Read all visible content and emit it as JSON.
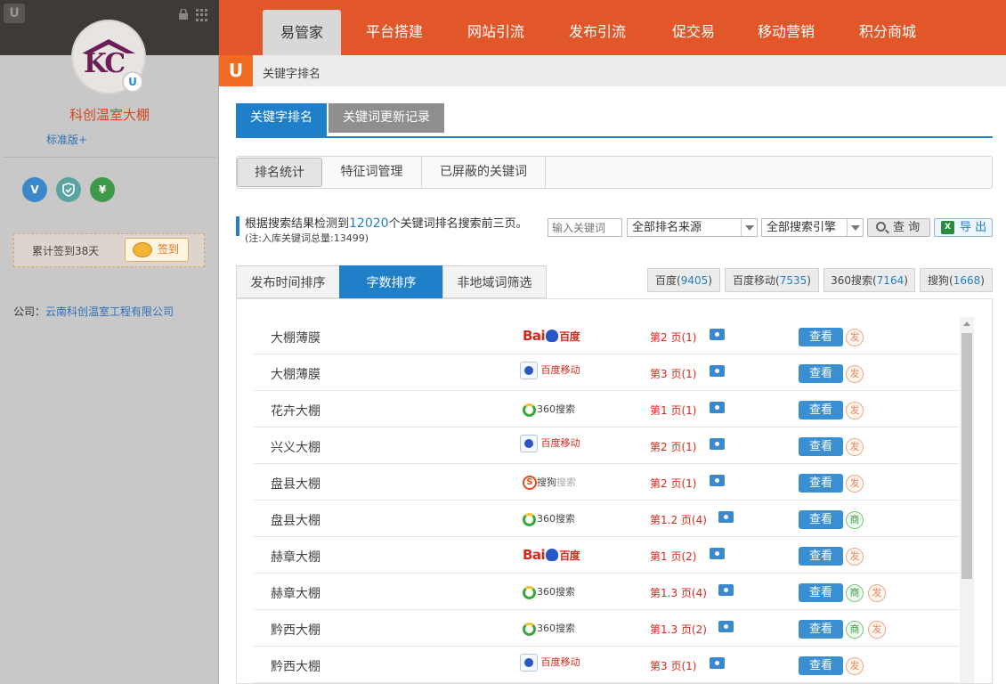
{
  "sidebar": {
    "company_name": "科创温室大棚",
    "edition": "标准版+",
    "avatar_text": "KC",
    "checkin_text": "累计签到38天",
    "checkin_button": "签到",
    "company_label": "公司：",
    "company_link": "云南科创温室工程有限公司",
    "icons": [
      "v-icon",
      "shield-icon",
      "yuan-icon"
    ]
  },
  "nav": {
    "items": [
      "易管家",
      "平台搭建",
      "网站引流",
      "发布引流",
      "促交易",
      "移动营销",
      "积分商城"
    ],
    "active": "易管家"
  },
  "breadcrumb": {
    "text": "关键字排名"
  },
  "main_tabs": [
    "关键字排名",
    "关键词更新记录"
  ],
  "sub_tabs": [
    "排名统计",
    "特征词管理",
    "已屏蔽的关键词"
  ],
  "info": {
    "prefix": "根据搜索结果检测到",
    "count": "12020",
    "suffix": "个关键词排名搜索前三页。",
    "note": "(注:入库关键词总量:13499)"
  },
  "filters": {
    "keyword_placeholder": "输入关键词",
    "source_select": "全部排名来源",
    "engine_select": "全部搜索引擎",
    "query_button": "查 询",
    "export_button": "导 出"
  },
  "sort_tabs": [
    "发布时间排序",
    "字数排序",
    "非地域词筛选"
  ],
  "engine_counts": [
    {
      "name": "百度",
      "count": "9405"
    },
    {
      "name": "百度移动",
      "count": "7535"
    },
    {
      "name": "360搜索",
      "count": "7164"
    },
    {
      "name": "搜狗",
      "count": "1668"
    }
  ],
  "engine_labels": {
    "baidu_a": "Bai",
    "baidu_b": "百度",
    "baidu_mobile": "百度移动",
    "s360": "360搜索",
    "sogou_a": "搜狗",
    "sogou_b": "搜索"
  },
  "view_label": "查看",
  "tag_labels": {
    "fa": "发",
    "shang": "商"
  },
  "rows": [
    {
      "keyword": "大棚薄膜",
      "engine": "baidu",
      "rank": "第2 页(1)",
      "tags": [
        "fa"
      ]
    },
    {
      "keyword": "大棚薄膜",
      "engine": "baidu_mobile",
      "rank": "第3 页(1)",
      "tags": [
        "fa"
      ]
    },
    {
      "keyword": "花卉大棚",
      "engine": "360",
      "rank": "第1 页(1)",
      "tags": [
        "fa"
      ]
    },
    {
      "keyword": "兴义大棚",
      "engine": "baidu_mobile",
      "rank": "第2 页(1)",
      "tags": [
        "fa"
      ]
    },
    {
      "keyword": "盘县大棚",
      "engine": "sogou",
      "rank": "第2 页(1)",
      "tags": [
        "fa"
      ]
    },
    {
      "keyword": "盘县大棚",
      "engine": "360",
      "rank": "第1.2 页(4)",
      "tags": [
        "shang"
      ]
    },
    {
      "keyword": "赫章大棚",
      "engine": "baidu",
      "rank": "第1 页(2)",
      "tags": [
        "fa"
      ]
    },
    {
      "keyword": "赫章大棚",
      "engine": "360",
      "rank": "第1.3 页(4)",
      "tags": [
        "shang",
        "fa"
      ]
    },
    {
      "keyword": "黔西大棚",
      "engine": "360",
      "rank": "第1.3 页(2)",
      "tags": [
        "shang",
        "fa"
      ]
    },
    {
      "keyword": "黔西大棚",
      "engine": "baidu_mobile",
      "rank": "第3 页(1)",
      "tags": [
        "fa"
      ]
    }
  ]
}
